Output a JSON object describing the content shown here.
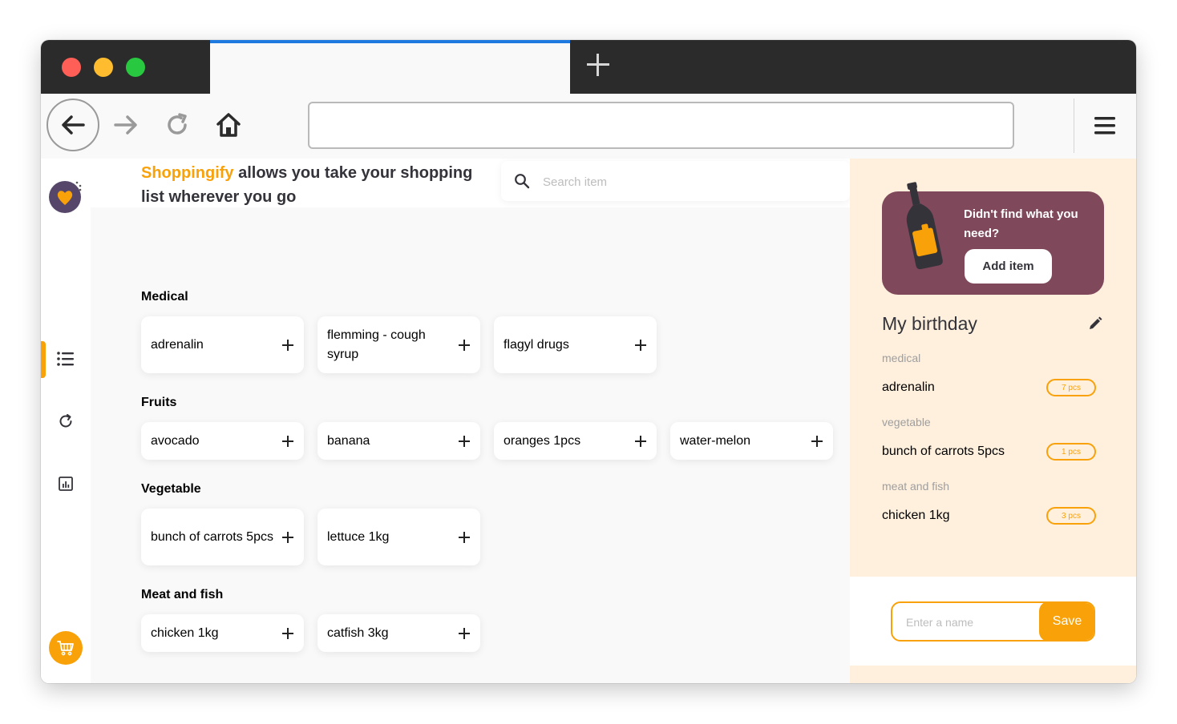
{
  "browser": {
    "new_tab_icon": "plus-icon",
    "back_icon": "arrow-left-icon",
    "forward_icon": "arrow-right-icon",
    "reload_icon": "reload-icon",
    "home_icon": "home-icon",
    "menu_icon": "hamburger-icon",
    "url_value": ""
  },
  "sidebar": {
    "logo_icon": "logo-icon",
    "items": [
      {
        "icon": "list-icon",
        "active": true
      },
      {
        "icon": "history-icon",
        "active": false
      },
      {
        "icon": "statistics-icon",
        "active": false
      }
    ],
    "cart_icon": "cart-icon"
  },
  "hero": {
    "brand": "Shoppingify",
    "text": " allows you take your shopping list wherever you go"
  },
  "search": {
    "placeholder": "Search item",
    "value": ""
  },
  "categories": [
    {
      "title": "Medical",
      "items": [
        "adrenalin",
        "flemming - cough syrup",
        "flagyl drugs"
      ]
    },
    {
      "title": "Fruits",
      "items": [
        "avocado",
        "banana",
        "oranges 1pcs",
        "water-melon"
      ]
    },
    {
      "title": "Vegetable",
      "items": [
        "bunch of carrots 5pcs",
        "lettuce 1kg"
      ]
    },
    {
      "title": "Meat and fish",
      "items": [
        "chicken 1kg",
        "catfish 3kg"
      ]
    }
  ],
  "promo": {
    "text": "Didn't find what you need?",
    "button": "Add item"
  },
  "shopping_list": {
    "title": "My birthday",
    "groups": [
      {
        "category": "medical",
        "item": "adrenalin",
        "qty": "7 pcs"
      },
      {
        "category": "vegetable",
        "item": "bunch of carrots 5pcs",
        "qty": "1 pcs"
      },
      {
        "category": "meat and fish",
        "item": "chicken 1kg",
        "qty": "3 pcs"
      }
    ]
  },
  "save": {
    "placeholder": "Enter a name",
    "value": "",
    "button": "Save"
  },
  "colors": {
    "accent": "#f9a109",
    "promo_bg": "#80485b",
    "panel_bg": "#fff0de",
    "text_dark": "#34333a"
  }
}
